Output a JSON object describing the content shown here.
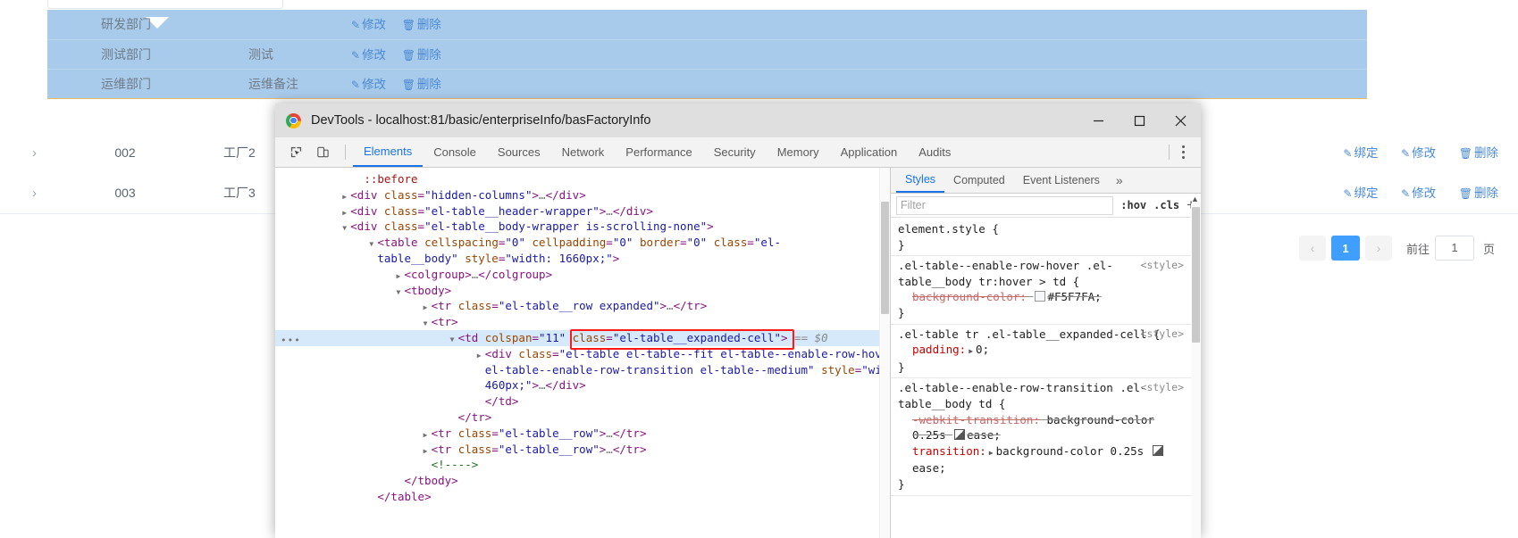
{
  "background": {
    "expanded_rows": [
      {
        "name": "研发部门",
        "note": "",
        "actions": [
          "修改",
          "删除"
        ]
      },
      {
        "name": "测试部门",
        "note": "测试",
        "actions": [
          "修改",
          "删除"
        ]
      },
      {
        "name": "运维部门",
        "note": "运维备注",
        "actions": [
          "修改",
          "删除"
        ]
      }
    ],
    "rows": [
      {
        "code": "002",
        "name": "工厂2",
        "actions": [
          "绑定",
          "修改",
          "删除"
        ]
      },
      {
        "code": "003",
        "name": "工厂3",
        "actions": [
          "绑定",
          "修改",
          "删除"
        ]
      }
    ],
    "pagination": {
      "prev": "‹",
      "current_page": "1",
      "next": "›",
      "goto_label": "前往",
      "goto_value": "1",
      "page_unit": "页"
    }
  },
  "devtools": {
    "window": {
      "title": "DevTools - localhost:81/basic/enterpriseInfo/basFactoryInfo",
      "minimize": "minimize-icon",
      "maximize": "maximize-icon",
      "close": "close-icon"
    },
    "toolbar": {
      "inspect_icon": "inspect-element-icon",
      "device_icon": "device-toolbar-icon",
      "kebab": "more-options-icon"
    },
    "tabs": [
      {
        "label": "Elements",
        "active": true
      },
      {
        "label": "Console",
        "active": false
      },
      {
        "label": "Sources",
        "active": false
      },
      {
        "label": "Network",
        "active": false
      },
      {
        "label": "Performance",
        "active": false
      },
      {
        "label": "Security",
        "active": false
      },
      {
        "label": "Memory",
        "active": false
      },
      {
        "label": "Application",
        "active": false
      },
      {
        "label": "Audits",
        "active": false
      }
    ],
    "dom_tree": [
      {
        "indent": 6,
        "tri": "none",
        "parts": [
          {
            "t": "pseudo",
            "v": "::before"
          }
        ]
      },
      {
        "indent": 5,
        "tri": "closed",
        "parts": [
          {
            "t": "pun",
            "v": "<"
          },
          {
            "t": "tw",
            "v": "div"
          },
          {
            "t": "plain",
            "v": " "
          },
          {
            "t": "an",
            "v": "class"
          },
          {
            "t": "pun",
            "v": "="
          },
          {
            "t": "av",
            "v": "\"hidden-columns\""
          },
          {
            "t": "pun",
            "v": ">"
          },
          {
            "t": "ellip",
            "v": "…"
          },
          {
            "t": "pun",
            "v": "</"
          },
          {
            "t": "tw",
            "v": "div"
          },
          {
            "t": "pun",
            "v": ">"
          }
        ]
      },
      {
        "indent": 5,
        "tri": "closed",
        "parts": [
          {
            "t": "pun",
            "v": "<"
          },
          {
            "t": "tw",
            "v": "div"
          },
          {
            "t": "plain",
            "v": " "
          },
          {
            "t": "an",
            "v": "class"
          },
          {
            "t": "pun",
            "v": "="
          },
          {
            "t": "av",
            "v": "\"el-table__header-wrapper\""
          },
          {
            "t": "pun",
            "v": ">"
          },
          {
            "t": "ellip",
            "v": "…"
          },
          {
            "t": "pun",
            "v": "</"
          },
          {
            "t": "tw",
            "v": "div"
          },
          {
            "t": "pun",
            "v": ">"
          }
        ]
      },
      {
        "indent": 5,
        "tri": "open",
        "parts": [
          {
            "t": "pun",
            "v": "<"
          },
          {
            "t": "tw",
            "v": "div"
          },
          {
            "t": "plain",
            "v": " "
          },
          {
            "t": "an",
            "v": "class"
          },
          {
            "t": "pun",
            "v": "="
          },
          {
            "t": "av",
            "v": "\"el-table__body-wrapper is-scrolling-none\""
          },
          {
            "t": "pun",
            "v": ">"
          }
        ]
      },
      {
        "indent": 7,
        "tri": "open",
        "parts": [
          {
            "t": "pun",
            "v": "<"
          },
          {
            "t": "tw",
            "v": "table"
          },
          {
            "t": "plain",
            "v": " "
          },
          {
            "t": "an",
            "v": "cellspacing"
          },
          {
            "t": "pun",
            "v": "="
          },
          {
            "t": "av",
            "v": "\"0\""
          },
          {
            "t": "plain",
            "v": " "
          },
          {
            "t": "an",
            "v": "cellpadding"
          },
          {
            "t": "pun",
            "v": "="
          },
          {
            "t": "av",
            "v": "\"0\""
          },
          {
            "t": "plain",
            "v": " "
          },
          {
            "t": "an",
            "v": "border"
          },
          {
            "t": "pun",
            "v": "="
          },
          {
            "t": "av",
            "v": "\"0\""
          },
          {
            "t": "plain",
            "v": " "
          },
          {
            "t": "an",
            "v": "class"
          },
          {
            "t": "pun",
            "v": "="
          },
          {
            "t": "av",
            "v": "\"el-"
          }
        ]
      },
      {
        "indent": 7,
        "tri": "none",
        "parts": [
          {
            "t": "av",
            "v": "table__body\""
          },
          {
            "t": "plain",
            "v": " "
          },
          {
            "t": "an",
            "v": "style"
          },
          {
            "t": "pun",
            "v": "="
          },
          {
            "t": "av",
            "v": "\"width: 1660px;\""
          },
          {
            "t": "pun",
            "v": ">"
          }
        ]
      },
      {
        "indent": 9,
        "tri": "closed",
        "parts": [
          {
            "t": "pun",
            "v": "<"
          },
          {
            "t": "tw",
            "v": "colgroup"
          },
          {
            "t": "pun",
            "v": ">"
          },
          {
            "t": "ellip",
            "v": "…"
          },
          {
            "t": "pun",
            "v": "</"
          },
          {
            "t": "tw",
            "v": "colgroup"
          },
          {
            "t": "pun",
            "v": ">"
          }
        ]
      },
      {
        "indent": 9,
        "tri": "open",
        "parts": [
          {
            "t": "pun",
            "v": "<"
          },
          {
            "t": "tw",
            "v": "tbody"
          },
          {
            "t": "pun",
            "v": ">"
          }
        ]
      },
      {
        "indent": 11,
        "tri": "closed",
        "parts": [
          {
            "t": "pun",
            "v": "<"
          },
          {
            "t": "tw",
            "v": "tr"
          },
          {
            "t": "plain",
            "v": " "
          },
          {
            "t": "an",
            "v": "class"
          },
          {
            "t": "pun",
            "v": "="
          },
          {
            "t": "av",
            "v": "\"el-table__row expanded\""
          },
          {
            "t": "pun",
            "v": ">"
          },
          {
            "t": "ellip",
            "v": "…"
          },
          {
            "t": "pun",
            "v": "</"
          },
          {
            "t": "tw",
            "v": "tr"
          },
          {
            "t": "pun",
            "v": ">"
          }
        ]
      },
      {
        "indent": 11,
        "tri": "open",
        "parts": [
          {
            "t": "pun",
            "v": "<"
          },
          {
            "t": "tw",
            "v": "tr"
          },
          {
            "t": "pun",
            "v": ">"
          }
        ]
      },
      {
        "indent": 13,
        "tri": "open",
        "selected": true,
        "parts": [
          {
            "t": "pun",
            "v": "<"
          },
          {
            "t": "tw",
            "v": "td"
          },
          {
            "t": "plain",
            "v": " "
          },
          {
            "t": "an",
            "v": "colspan"
          },
          {
            "t": "pun",
            "v": "="
          },
          {
            "t": "av",
            "v": "\"11\""
          },
          {
            "t": "plain",
            "v": " "
          },
          {
            "t": "an",
            "v": "class"
          },
          {
            "t": "pun",
            "v": "="
          },
          {
            "t": "av",
            "v": "\"el-table__expanded-cell\""
          },
          {
            "t": "pun",
            "v": ">"
          },
          {
            "t": "plain",
            "v": " "
          },
          {
            "t": "dollar",
            "v": "== $0"
          }
        ]
      },
      {
        "indent": 15,
        "tri": "closed",
        "parts": [
          {
            "t": "pun",
            "v": "<"
          },
          {
            "t": "tw",
            "v": "div"
          },
          {
            "t": "plain",
            "v": " "
          },
          {
            "t": "an",
            "v": "class"
          },
          {
            "t": "pun",
            "v": "="
          },
          {
            "t": "av",
            "v": "\"el-table el-table--fit el-table--enable-row-hover"
          }
        ]
      },
      {
        "indent": 15,
        "tri": "none",
        "parts": [
          {
            "t": "av",
            "v": "el-table--enable-row-transition el-table--medium\""
          },
          {
            "t": "plain",
            "v": " "
          },
          {
            "t": "an",
            "v": "style"
          },
          {
            "t": "pun",
            "v": "="
          },
          {
            "t": "av",
            "v": "\"width:"
          }
        ]
      },
      {
        "indent": 15,
        "tri": "none",
        "parts": [
          {
            "t": "av",
            "v": "460px;\""
          },
          {
            "t": "pun",
            "v": ">"
          },
          {
            "t": "ellip",
            "v": "…"
          },
          {
            "t": "pun",
            "v": "</"
          },
          {
            "t": "tw",
            "v": "div"
          },
          {
            "t": "pun",
            "v": ">"
          }
        ]
      },
      {
        "indent": 15,
        "tri": "none",
        "parts": [
          {
            "t": "pun",
            "v": "</"
          },
          {
            "t": "tw",
            "v": "td"
          },
          {
            "t": "pun",
            "v": ">"
          }
        ]
      },
      {
        "indent": 13,
        "tri": "none",
        "parts": [
          {
            "t": "pun",
            "v": "</"
          },
          {
            "t": "tw",
            "v": "tr"
          },
          {
            "t": "pun",
            "v": ">"
          }
        ]
      },
      {
        "indent": 11,
        "tri": "closed",
        "parts": [
          {
            "t": "pun",
            "v": "<"
          },
          {
            "t": "tw",
            "v": "tr"
          },
          {
            "t": "plain",
            "v": " "
          },
          {
            "t": "an",
            "v": "class"
          },
          {
            "t": "pun",
            "v": "="
          },
          {
            "t": "av",
            "v": "\"el-table__row\""
          },
          {
            "t": "pun",
            "v": ">"
          },
          {
            "t": "ellip",
            "v": "…"
          },
          {
            "t": "pun",
            "v": "</"
          },
          {
            "t": "tw",
            "v": "tr"
          },
          {
            "t": "pun",
            "v": ">"
          }
        ]
      },
      {
        "indent": 11,
        "tri": "closed",
        "parts": [
          {
            "t": "pun",
            "v": "<"
          },
          {
            "t": "tw",
            "v": "tr"
          },
          {
            "t": "plain",
            "v": " "
          },
          {
            "t": "an",
            "v": "class"
          },
          {
            "t": "pun",
            "v": "="
          },
          {
            "t": "av",
            "v": "\"el-table__row\""
          },
          {
            "t": "pun",
            "v": ">"
          },
          {
            "t": "ellip",
            "v": "…"
          },
          {
            "t": "pun",
            "v": "</"
          },
          {
            "t": "tw",
            "v": "tr"
          },
          {
            "t": "pun",
            "v": ">"
          }
        ]
      },
      {
        "indent": 11,
        "tri": "none",
        "parts": [
          {
            "t": "cmt",
            "v": "<!---->"
          }
        ]
      },
      {
        "indent": 9,
        "tri": "none",
        "parts": [
          {
            "t": "pun",
            "v": "</"
          },
          {
            "t": "tw",
            "v": "tbody"
          },
          {
            "t": "pun",
            "v": ">"
          }
        ]
      },
      {
        "indent": 7,
        "tri": "none",
        "parts": [
          {
            "t": "pun",
            "v": "</"
          },
          {
            "t": "tw",
            "v": "table"
          },
          {
            "t": "pun",
            "v": ">"
          }
        ]
      }
    ],
    "styles": {
      "tabs": [
        {
          "label": "Styles",
          "active": true
        },
        {
          "label": "Computed",
          "active": false
        },
        {
          "label": "Event Listeners",
          "active": false
        }
      ],
      "more": "»",
      "filter_placeholder": "Filter",
      "hov_label": ":hov",
      "cls_label": ".cls",
      "plus_label": "+",
      "rules": [
        {
          "selector": "element.style {",
          "close": "}",
          "source": "",
          "declarations": []
        },
        {
          "selector": ".el-table--enable-row-hover .el-table__body tr:hover > td {",
          "close": "}",
          "source": "<style>",
          "declarations": [
            {
              "prop": "background-color:",
              "value": "#F5F7FA;",
              "struck": true,
              "swatch": "#F5F7FA"
            }
          ]
        },
        {
          "selector": ".el-table tr .el-table__expanded-cell {",
          "close": "}",
          "source": "<style>",
          "declarations": [
            {
              "prop": "padding:",
              "value": "0;",
              "struck": false,
              "expandable": true
            }
          ]
        },
        {
          "selector": ".el-table--enable-row-transition .el-table__body td {",
          "close": "}",
          "source": "<style>",
          "declarations": [
            {
              "prop": "-webkit-transition:",
              "value": "background-color 0.25s ease;",
              "struck": true
            },
            {
              "prop": "transition:",
              "value": "background-color 0.25s ease;",
              "struck": false,
              "expandable": true
            }
          ]
        }
      ]
    }
  }
}
